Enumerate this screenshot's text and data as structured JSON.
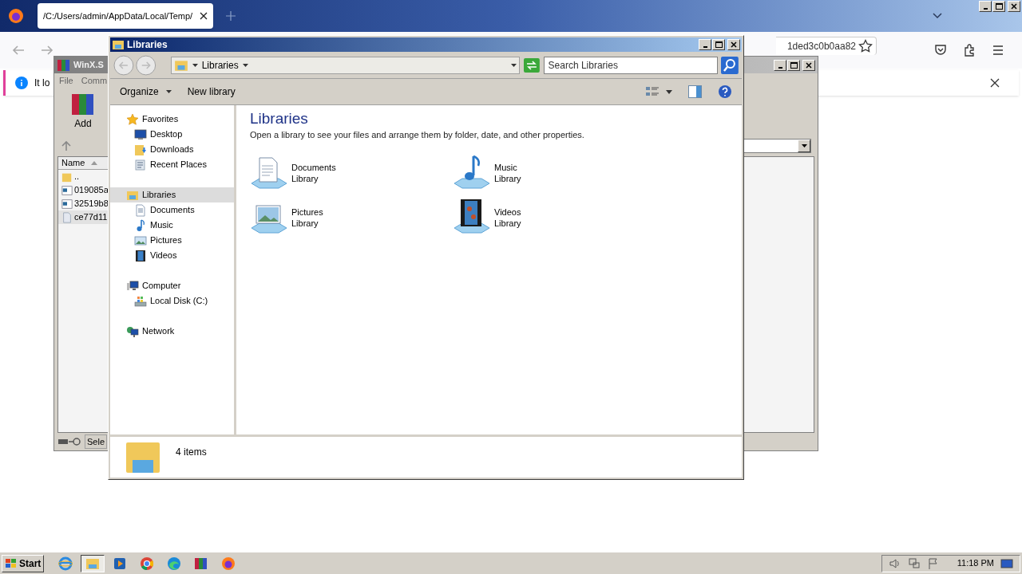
{
  "browser": {
    "tab_title": "/C:/Users/admin/AppData/Local/Temp/",
    "url_fragment": "1ded3c0b0aa82",
    "notification": "It lo"
  },
  "winrar": {
    "title": "WinX.S",
    "menu": [
      "File",
      "Comm"
    ],
    "toolbar": [
      "Add"
    ],
    "column": "Name",
    "files": [
      {
        "name": "..",
        "kind": "folder",
        "selected": false
      },
      {
        "name": "019085a",
        "kind": "exe",
        "selected": false
      },
      {
        "name": "32519b8",
        "kind": "exe",
        "selected": false
      },
      {
        "name": "ce77d11",
        "kind": "file",
        "selected": true
      }
    ],
    "status": "Sele"
  },
  "explorer": {
    "title": "Libraries",
    "breadcrumb": "Libraries",
    "search": {
      "placeholder": "Search Libraries"
    },
    "commands": [
      "Organize",
      "New library"
    ],
    "nav": [
      {
        "label": "Favorites",
        "kind": "star",
        "selected": false,
        "children": [
          {
            "label": "Desktop",
            "kind": "desktop",
            "selected": false
          },
          {
            "label": "Downloads",
            "kind": "downloads",
            "selected": false
          },
          {
            "label": "Recent Places",
            "kind": "recent",
            "selected": false
          }
        ]
      },
      {
        "label": "Libraries",
        "kind": "library",
        "selected": true,
        "children": [
          {
            "label": "Documents",
            "kind": "documents",
            "selected": false
          },
          {
            "label": "Music",
            "kind": "music",
            "selected": false
          },
          {
            "label": "Pictures",
            "kind": "pictures",
            "selected": false
          },
          {
            "label": "Videos",
            "kind": "videos",
            "selected": false
          }
        ]
      },
      {
        "label": "Computer",
        "kind": "computer",
        "selected": false,
        "children": [
          {
            "label": "Local Disk (C:)",
            "kind": "disk",
            "selected": false
          }
        ]
      },
      {
        "label": "Network",
        "kind": "network",
        "selected": false
      }
    ],
    "heading": "Libraries",
    "description": "Open a library to see your files and arrange them by folder, date, and other properties.",
    "libraries": [
      {
        "name": "Documents",
        "sub": "Library",
        "kind": "documents"
      },
      {
        "name": "Music",
        "sub": "Library",
        "kind": "music"
      },
      {
        "name": "Pictures",
        "sub": "Library",
        "kind": "pictures"
      },
      {
        "name": "Videos",
        "sub": "Library",
        "kind": "videos"
      }
    ],
    "status": "4 items"
  },
  "taskbar": {
    "start": "Start",
    "apps": [
      {
        "kind": "ie",
        "selected": false
      },
      {
        "kind": "explorer",
        "selected": true
      },
      {
        "kind": "media",
        "selected": false
      },
      {
        "kind": "chrome",
        "selected": false
      },
      {
        "kind": "edge",
        "selected": false
      },
      {
        "kind": "winrar",
        "selected": false
      },
      {
        "kind": "firefox",
        "selected": false
      }
    ],
    "clock": "11:18 PM"
  }
}
